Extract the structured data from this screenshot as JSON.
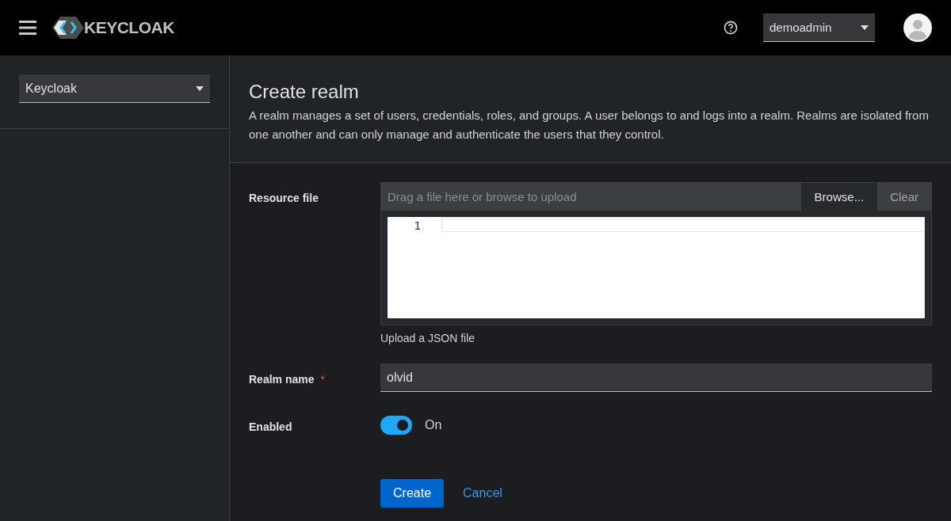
{
  "header": {
    "logo_text": "KEYCLOAK",
    "user": "demoadmin"
  },
  "sidebar": {
    "realm_select": "Keycloak"
  },
  "page": {
    "title": "Create realm",
    "description": "A realm manages a set of users, credentials, roles, and groups. A user belongs to and logs into a realm. Realms are isolated from one another and can only manage and authenticate the users that they control."
  },
  "form": {
    "resource_file": {
      "label": "Resource file",
      "placeholder": "Drag a file here or browse to upload",
      "browse": "Browse...",
      "clear": "Clear",
      "line_numbers": [
        "1"
      ],
      "helper": "Upload a JSON file"
    },
    "realm_name": {
      "label": "Realm name",
      "required_mark": "*",
      "value": "olvid"
    },
    "enabled": {
      "label": "Enabled",
      "on": true,
      "state_text": "On"
    }
  },
  "buttons": {
    "create": "Create",
    "cancel": "Cancel"
  }
}
